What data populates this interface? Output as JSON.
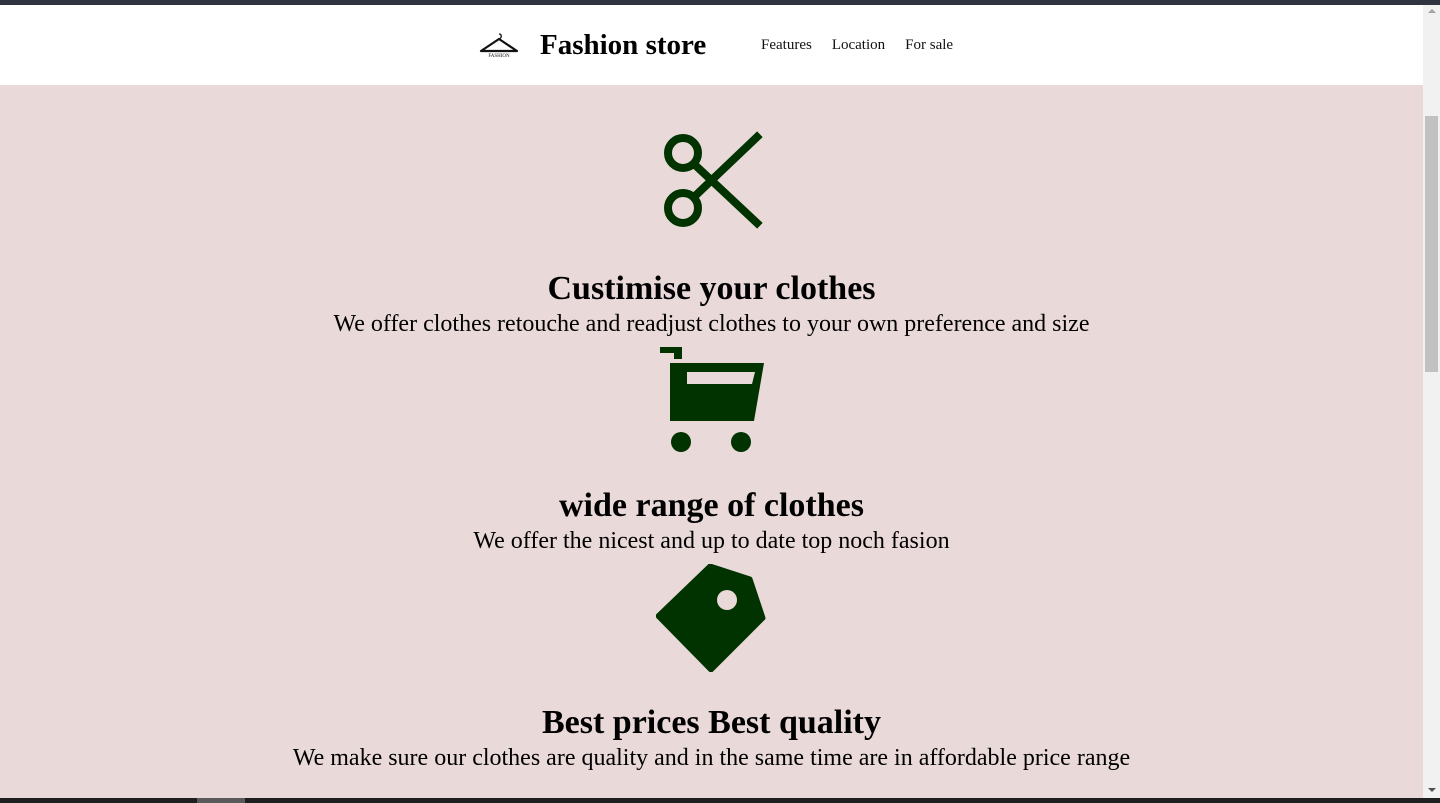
{
  "header": {
    "logo_text": "FASHION",
    "brand": "Fashion store",
    "nav": [
      "Features",
      "Location",
      "For sale"
    ]
  },
  "features": [
    {
      "icon": "scissors-icon",
      "title": "Custimise your clothes",
      "description": "We offer clothes retouche and readjust clothes to your own preference and size"
    },
    {
      "icon": "shopping-cart-icon",
      "title": "wide range of clothes",
      "description": "We offer the nicest and up to date top noch fasion"
    },
    {
      "icon": "price-tag-icon",
      "title": "Best prices Best quality",
      "description": "We make sure our clothes are quality and in the same time are in affordable price range"
    }
  ],
  "colors": {
    "page_background": "#ead9d9",
    "header_background": "#ffffff",
    "icon_color": "#003300"
  }
}
